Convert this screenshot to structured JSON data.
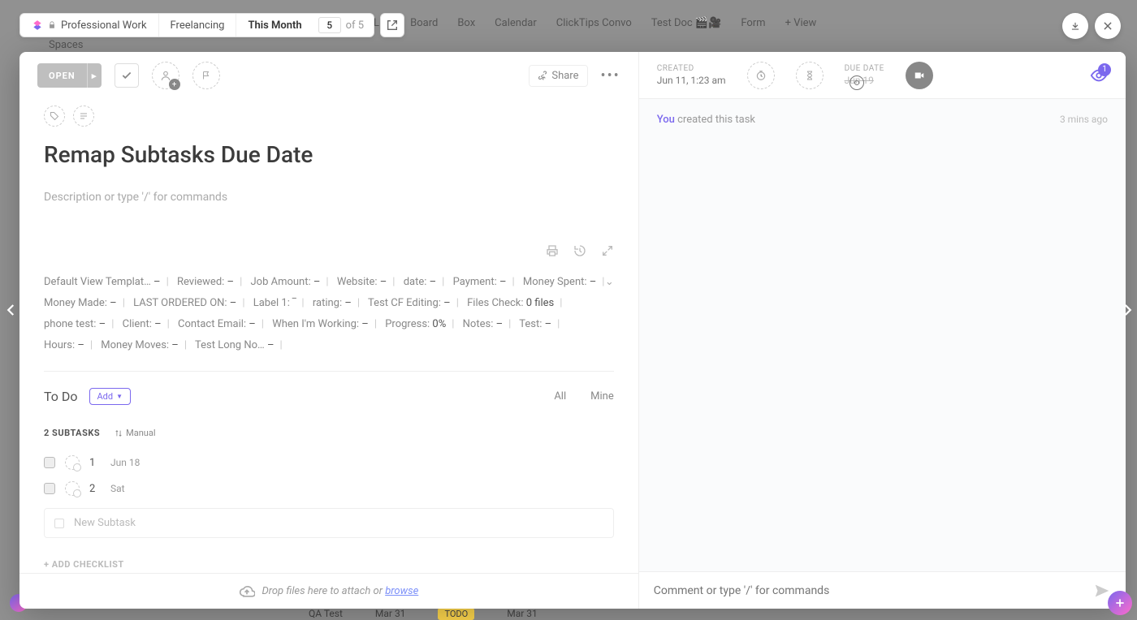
{
  "breadcrumb": {
    "space": "Professional Work",
    "folder": "Freelancing",
    "list": "This Month",
    "index": "5",
    "total": "of 5"
  },
  "bg": {
    "views": [
      "List",
      "Board",
      "Box",
      "Calendar",
      "ClickTips Convo",
      "Test Doc 🎬🎥",
      "Form",
      "+ View"
    ],
    "spaces": "Spaces",
    "row_task": "QA Test",
    "row_date1": "Mar 31",
    "row_status": "TODO",
    "row_date2": "Mar 31"
  },
  "toolbar": {
    "status": "OPEN",
    "share": "Share"
  },
  "task": {
    "title": "Remap Subtasks Due Date",
    "desc_placeholder": "Description or type '/' for commands"
  },
  "fields": [
    {
      "k": "Default View Templat…",
      "v": "–"
    },
    {
      "k": "Reviewed:",
      "v": "–"
    },
    {
      "k": "Job Amount:",
      "v": "–"
    },
    {
      "k": "Website:",
      "v": "–"
    },
    {
      "k": "date:",
      "v": "–"
    },
    {
      "k": "Payment:",
      "v": "–"
    },
    {
      "k": "Money Spent:",
      "v": "–"
    },
    {
      "k": "Money Made:",
      "v": "–"
    },
    {
      "k": "LAST ORDERED ON:",
      "v": "–"
    },
    {
      "k": "Label 1:",
      "v": "‾"
    },
    {
      "k": "rating:",
      "v": "–"
    },
    {
      "k": "Test CF Editing:",
      "v": "–"
    },
    {
      "k": "Files Check:",
      "v": "0 files"
    },
    {
      "k": "phone test:",
      "v": "–"
    },
    {
      "k": "Client:",
      "v": "–"
    },
    {
      "k": "Contact Email:",
      "v": "–"
    },
    {
      "k": "When I'm Working:",
      "v": "–"
    },
    {
      "k": "Progress:",
      "v": "0%"
    },
    {
      "k": "Notes:",
      "v": "–"
    },
    {
      "k": "Test:",
      "v": "–"
    },
    {
      "k": "Hours:",
      "v": "–"
    },
    {
      "k": "Money Moves:",
      "v": "–"
    },
    {
      "k": "Test Long No…",
      "v": "–"
    }
  ],
  "todo": {
    "title": "To Do",
    "add": "Add",
    "tab_all": "All",
    "tab_mine": "Mine",
    "count": "2 SUBTASKS",
    "sort": "Manual",
    "items": [
      {
        "name": "1",
        "date": "Jun 18"
      },
      {
        "name": "2",
        "date": "Sat"
      }
    ],
    "new_placeholder": "New Subtask",
    "add_checklist": "+ ADD CHECKLIST"
  },
  "dropzone": {
    "text": "Drop files here to attach or ",
    "link": "browse"
  },
  "meta": {
    "created_label": "CREATED",
    "created_val": "Jun 11, 1:23 am",
    "due_label": "DUE DATE",
    "due_val": "Jun 19",
    "watch_count": "1"
  },
  "activity": {
    "you": "You",
    "text": " created this task",
    "time": "3 mins ago"
  },
  "comment": {
    "placeholder": "Comment or type '/' for commands"
  }
}
